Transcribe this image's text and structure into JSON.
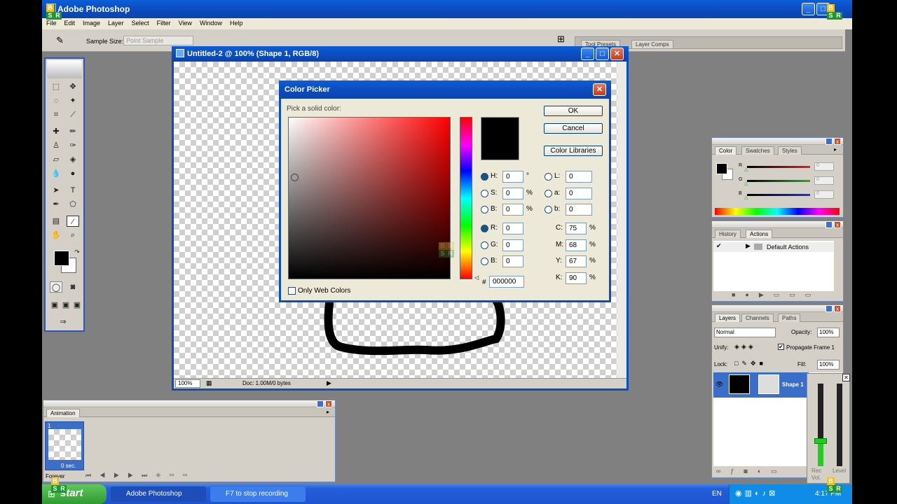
{
  "app": {
    "title": "Adobe Photoshop",
    "menu": [
      "File",
      "Edit",
      "Image",
      "Layer",
      "Select",
      "Filter",
      "View",
      "Window",
      "Help"
    ],
    "sample_size_label": "Sample Size:",
    "sample_size_value": "Point Sample"
  },
  "palette_well": {
    "tabs": [
      "Tool Presets",
      "Layer Comps"
    ]
  },
  "document": {
    "title": "Untitled-2 @ 100% (Shape 1, RGB/8)",
    "zoom": "100%",
    "doc_info": "Doc: 1.00M/0 bytes"
  },
  "color_picker": {
    "title": "Color Picker",
    "prompt": "Pick a solid color:",
    "ok": "OK",
    "cancel": "Cancel",
    "libraries": "Color Libraries",
    "only_web": "Only Web Colors",
    "hsb": [
      {
        "label": "H:",
        "value": "0",
        "unit": "°"
      },
      {
        "label": "S:",
        "value": "0",
        "unit": "%"
      },
      {
        "label": "B:",
        "value": "0",
        "unit": "%"
      }
    ],
    "rgb": [
      {
        "label": "R:",
        "value": "0"
      },
      {
        "label": "G:",
        "value": "0"
      },
      {
        "label": "B:",
        "value": "0"
      }
    ],
    "lab": [
      {
        "label": "L:",
        "value": "0"
      },
      {
        "label": "a:",
        "value": "0"
      },
      {
        "label": "b:",
        "value": "0"
      }
    ],
    "cmyk": [
      {
        "label": "C:",
        "value": "75",
        "unit": "%"
      },
      {
        "label": "M:",
        "value": "68",
        "unit": "%"
      },
      {
        "label": "Y:",
        "value": "67",
        "unit": "%"
      },
      {
        "label": "K:",
        "value": "90",
        "unit": "%"
      }
    ],
    "hex_label": "#",
    "hex": "000000",
    "current_color": "#000000",
    "hue_color": "#ff0000"
  },
  "color_panel": {
    "tabs": [
      "Color",
      "Swatches",
      "Styles"
    ],
    "channels": [
      {
        "label": "R",
        "value": "0",
        "color": "#e02020"
      },
      {
        "label": "G",
        "value": "0",
        "color": "#20b020"
      },
      {
        "label": "B",
        "value": "0",
        "color": "#2030e0"
      }
    ]
  },
  "actions_panel": {
    "tabs": [
      "History",
      "Actions"
    ],
    "item": "Default Actions"
  },
  "layers_panel": {
    "tabs": [
      "Layers",
      "Channels",
      "Paths"
    ],
    "blend": "Normal",
    "opacity_label": "Opacity:",
    "opacity": "100%",
    "unify_label": "Unify:",
    "propagate": "Propagate Frame 1",
    "lock_label": "Lock:",
    "fill_label": "Fill:",
    "fill": "100%",
    "layer_name": "Shape 1"
  },
  "animation_panel": {
    "title": "Animation",
    "frame_num": "1",
    "frame_delay": "0 sec.",
    "loop": "Forever"
  },
  "recorder": {
    "rec_label": "Rec Vol.",
    "level_label": "Level"
  },
  "taskbar": {
    "start": "start",
    "items": [
      "Adobe Photoshop",
      "F7 to stop recording"
    ],
    "lang": "EN",
    "clock": "4:17 PM"
  },
  "bsr": {
    "b": "B",
    "s": "S",
    "r": "R"
  }
}
